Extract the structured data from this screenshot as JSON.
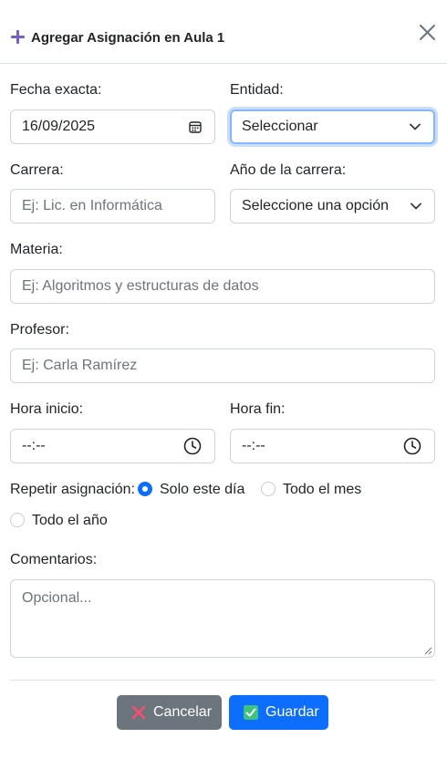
{
  "header": {
    "title": "Agregar Asignación en Aula 1",
    "plus_icon": "plus-icon",
    "close_icon": "close-icon"
  },
  "form": {
    "fecha": {
      "label": "Fecha exacta:",
      "value": "16/09/2025",
      "icon": "calendar-icon"
    },
    "entidad": {
      "label": "Entidad:",
      "value": "Seleccionar",
      "icon": "chevron-down-icon"
    },
    "carrera": {
      "label": "Carrera:",
      "placeholder": "Ej: Lic. en Informática"
    },
    "anio": {
      "label": "Año de la carrera:",
      "value": "Seleccione una opción",
      "icon": "chevron-down-icon"
    },
    "materia": {
      "label": "Materia:",
      "placeholder": "Ej: Algoritmos y estructuras de datos"
    },
    "profesor": {
      "label": "Profesor:",
      "placeholder": "Ej: Carla Ramírez"
    },
    "hora_inicio": {
      "label": "Hora inicio:",
      "value": "--:--",
      "icon": "clock-icon"
    },
    "hora_fin": {
      "label": "Hora fin:",
      "value": "--:--",
      "icon": "clock-icon"
    },
    "repetir": {
      "label": "Repetir asignación:",
      "options": [
        "Solo este día",
        "Todo el mes",
        "Todo el año"
      ],
      "selected": "Solo este día"
    },
    "comentarios": {
      "label": "Comentarios:",
      "placeholder": "Opcional..."
    }
  },
  "footer": {
    "cancel_label": "Cancelar",
    "cancel_icon": "x-mark-icon",
    "save_label": "Guardar",
    "save_icon": "check-box-icon"
  },
  "colors": {
    "primary": "#0d6efd",
    "secondary": "#6c757d",
    "accent_purple": "#7b5cc4",
    "cancel_x": "#ff4d6d",
    "save_check": "#3cc47c"
  }
}
